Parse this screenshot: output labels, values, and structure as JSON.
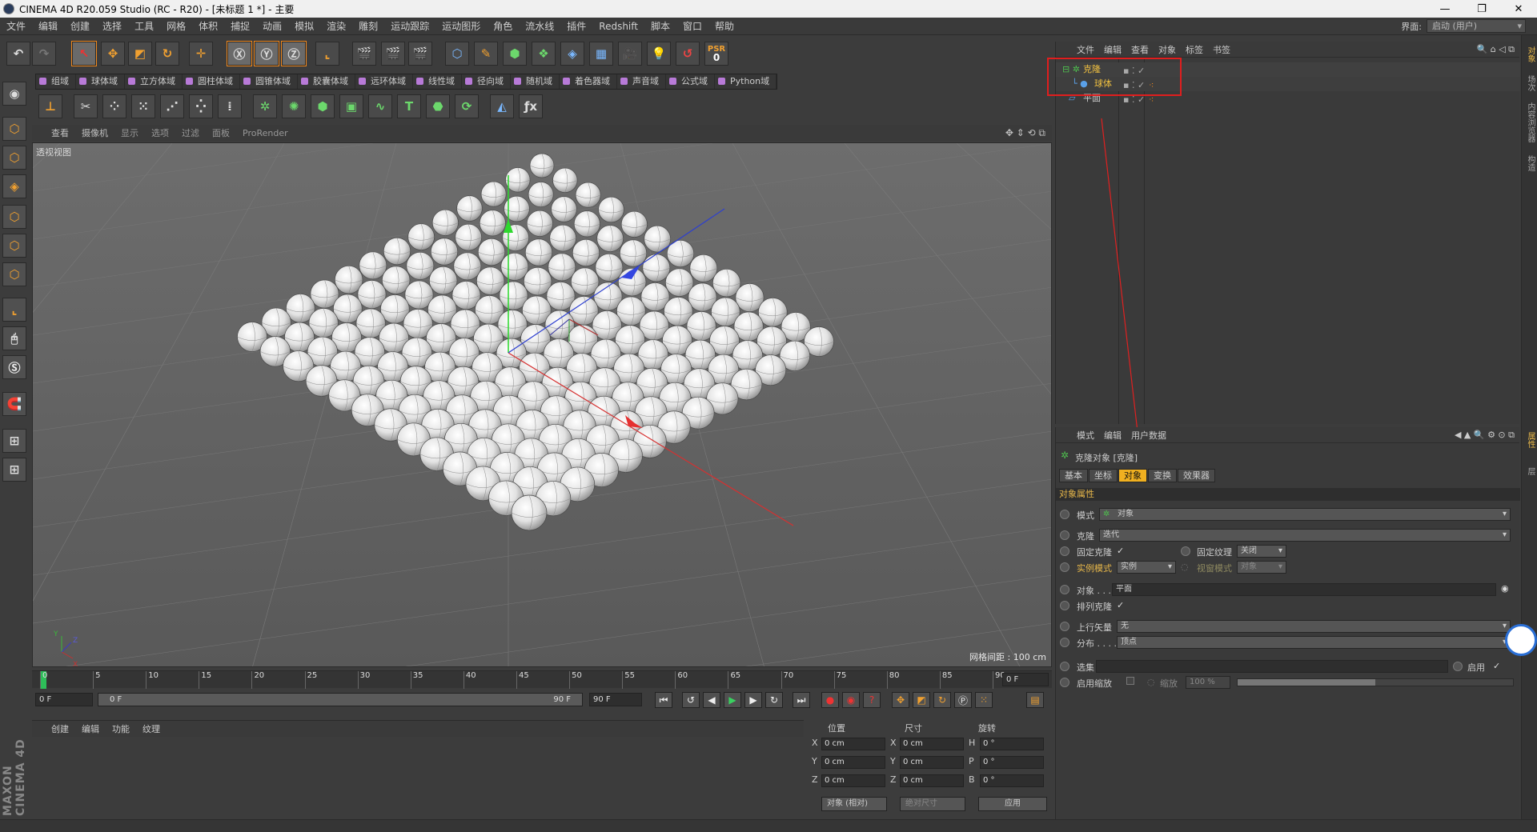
{
  "window": {
    "title": "CINEMA 4D R20.059 Studio (RC - R20) - [未标题 1 *] - 主要",
    "btn_min": "—",
    "btn_restore": "❐",
    "btn_close": "✕"
  },
  "menu": [
    "文件",
    "编辑",
    "创建",
    "选择",
    "工具",
    "网格",
    "体积",
    "捕捉",
    "动画",
    "模拟",
    "渲染",
    "雕刻",
    "运动跟踪",
    "运动图形",
    "角色",
    "流水线",
    "插件",
    "Redshift",
    "脚本",
    "窗口",
    "帮助"
  ],
  "layout": {
    "label": "界面:",
    "value": "启动 (用户)"
  },
  "fields": [
    "组域",
    "球体域",
    "立方体域",
    "圆柱体域",
    "圆锥体域",
    "胶囊体域",
    "远环体域",
    "线性域",
    "径向域",
    "随机域",
    "着色器域",
    "声音域",
    "公式域",
    "Python域"
  ],
  "psr": {
    "label": "PSR",
    "value": "0"
  },
  "viewport": {
    "menu": [
      "查看",
      "摄像机",
      "显示",
      "选项",
      "过滤",
      "面板",
      "ProRender"
    ],
    "label": "透视视图",
    "grid": "网格间距 : 100 cm",
    "axis_x": "X",
    "axis_y": "Y",
    "axis_z": "Z"
  },
  "timeline": {
    "ticks": [
      "0",
      "5",
      "10",
      "15",
      "20",
      "25",
      "30",
      "35",
      "40",
      "45",
      "50",
      "55",
      "60",
      "65",
      "70",
      "75",
      "80",
      "85",
      "90"
    ],
    "frame_end": "0 F"
  },
  "transport": {
    "start": "0 F",
    "slider_left": "0 F",
    "slider_right": "90 F",
    "end": "90 F"
  },
  "material": {
    "menu": [
      "创建",
      "编辑",
      "功能",
      "纹理"
    ]
  },
  "coords": {
    "headers": [
      "位置",
      "尺寸",
      "旋转"
    ],
    "rows": [
      {
        "a": "X",
        "p": "0 cm",
        "b": "X",
        "s": "0 cm",
        "c": "H",
        "r": "0 °"
      },
      {
        "a": "Y",
        "p": "0 cm",
        "b": "Y",
        "s": "0 cm",
        "c": "P",
        "r": "0 °"
      },
      {
        "a": "Z",
        "p": "0 cm",
        "b": "Z",
        "s": "0 cm",
        "c": "B",
        "r": "0 °"
      }
    ],
    "mode": "对象 (相对)",
    "size_mode": "绝对尺寸",
    "apply": "应用"
  },
  "brand": "MAXON CINEMA 4D",
  "objects": {
    "menu": [
      "文件",
      "编辑",
      "查看",
      "对象",
      "标签",
      "书签"
    ],
    "items": [
      {
        "name": "克隆",
        "color": "#f0c040"
      },
      {
        "name": "球体",
        "color": "#f0c040"
      },
      {
        "name": "平面",
        "color": "#cfcfcf"
      }
    ]
  },
  "attributes": {
    "menu": [
      "模式",
      "编辑",
      "用户数据"
    ],
    "header": "克隆对象 [克隆]",
    "tabs": [
      "基本",
      "坐标",
      "对象",
      "变换",
      "效果器"
    ],
    "active_tab": "对象",
    "section": "对象属性",
    "mode_label": "模式",
    "mode_value": "对象",
    "clone_label": "克隆",
    "clone_value": "迭代",
    "fix_clone": "固定克隆",
    "fix_clone_check": "✓",
    "fix_tex": "固定纹理",
    "fix_tex_value": "关闭",
    "instance_label": "实例模式",
    "instance_value": "实例",
    "viewport_mode": "视窗模式",
    "viewport_mode_value": "对象",
    "object_label": "对象 . . .",
    "object_value": "平面",
    "align_label": "排列克隆",
    "align_check": "✓",
    "up_label": "上行矢量",
    "up_value": "无",
    "dist_label": "分布 . . . .",
    "dist_value": "顶点",
    "sel_label": "选集",
    "enable_label": "启用",
    "enable_check": "✓",
    "scale_label": "启用缩放",
    "scale2_label": "缩放",
    "scale_value": "100 %"
  },
  "right_tabs": [
    "对象",
    "场次",
    "内容浏览器",
    "构造",
    "属性",
    "层"
  ],
  "accent": "#f0a030"
}
